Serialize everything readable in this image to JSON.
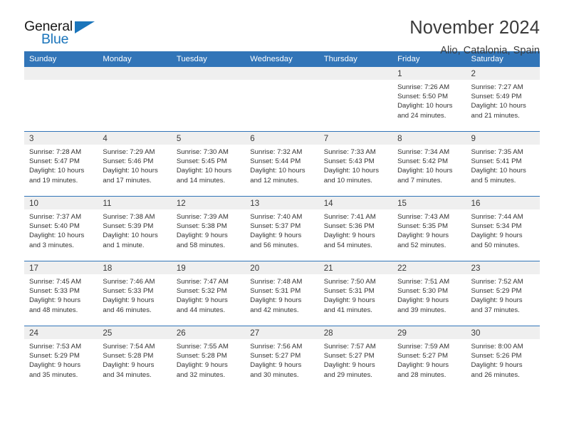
{
  "brand": {
    "name_part1": "General",
    "name_part2": "Blue",
    "accent_color": "#1b75bb"
  },
  "header": {
    "title": "November 2024",
    "location": "Alio, Catalonia, Spain",
    "header_bg": "#3275b8"
  },
  "calendar": {
    "weekday_headers": [
      "Sunday",
      "Monday",
      "Tuesday",
      "Wednesday",
      "Thursday",
      "Friday",
      "Saturday"
    ],
    "weeks": [
      [
        {
          "day": "",
          "blank": true
        },
        {
          "day": "",
          "blank": true
        },
        {
          "day": "",
          "blank": true
        },
        {
          "day": "",
          "blank": true
        },
        {
          "day": "",
          "blank": true
        },
        {
          "day": "1",
          "sunrise": "Sunrise: 7:26 AM",
          "sunset": "Sunset: 5:50 PM",
          "daylight": "Daylight: 10 hours and 24 minutes."
        },
        {
          "day": "2",
          "sunrise": "Sunrise: 7:27 AM",
          "sunset": "Sunset: 5:49 PM",
          "daylight": "Daylight: 10 hours and 21 minutes."
        }
      ],
      [
        {
          "day": "3",
          "sunrise": "Sunrise: 7:28 AM",
          "sunset": "Sunset: 5:47 PM",
          "daylight": "Daylight: 10 hours and 19 minutes."
        },
        {
          "day": "4",
          "sunrise": "Sunrise: 7:29 AM",
          "sunset": "Sunset: 5:46 PM",
          "daylight": "Daylight: 10 hours and 17 minutes."
        },
        {
          "day": "5",
          "sunrise": "Sunrise: 7:30 AM",
          "sunset": "Sunset: 5:45 PM",
          "daylight": "Daylight: 10 hours and 14 minutes."
        },
        {
          "day": "6",
          "sunrise": "Sunrise: 7:32 AM",
          "sunset": "Sunset: 5:44 PM",
          "daylight": "Daylight: 10 hours and 12 minutes."
        },
        {
          "day": "7",
          "sunrise": "Sunrise: 7:33 AM",
          "sunset": "Sunset: 5:43 PM",
          "daylight": "Daylight: 10 hours and 10 minutes."
        },
        {
          "day": "8",
          "sunrise": "Sunrise: 7:34 AM",
          "sunset": "Sunset: 5:42 PM",
          "daylight": "Daylight: 10 hours and 7 minutes."
        },
        {
          "day": "9",
          "sunrise": "Sunrise: 7:35 AM",
          "sunset": "Sunset: 5:41 PM",
          "daylight": "Daylight: 10 hours and 5 minutes."
        }
      ],
      [
        {
          "day": "10",
          "sunrise": "Sunrise: 7:37 AM",
          "sunset": "Sunset: 5:40 PM",
          "daylight": "Daylight: 10 hours and 3 minutes."
        },
        {
          "day": "11",
          "sunrise": "Sunrise: 7:38 AM",
          "sunset": "Sunset: 5:39 PM",
          "daylight": "Daylight: 10 hours and 1 minute."
        },
        {
          "day": "12",
          "sunrise": "Sunrise: 7:39 AM",
          "sunset": "Sunset: 5:38 PM",
          "daylight": "Daylight: 9 hours and 58 minutes."
        },
        {
          "day": "13",
          "sunrise": "Sunrise: 7:40 AM",
          "sunset": "Sunset: 5:37 PM",
          "daylight": "Daylight: 9 hours and 56 minutes."
        },
        {
          "day": "14",
          "sunrise": "Sunrise: 7:41 AM",
          "sunset": "Sunset: 5:36 PM",
          "daylight": "Daylight: 9 hours and 54 minutes."
        },
        {
          "day": "15",
          "sunrise": "Sunrise: 7:43 AM",
          "sunset": "Sunset: 5:35 PM",
          "daylight": "Daylight: 9 hours and 52 minutes."
        },
        {
          "day": "16",
          "sunrise": "Sunrise: 7:44 AM",
          "sunset": "Sunset: 5:34 PM",
          "daylight": "Daylight: 9 hours and 50 minutes."
        }
      ],
      [
        {
          "day": "17",
          "sunrise": "Sunrise: 7:45 AM",
          "sunset": "Sunset: 5:33 PM",
          "daylight": "Daylight: 9 hours and 48 minutes."
        },
        {
          "day": "18",
          "sunrise": "Sunrise: 7:46 AM",
          "sunset": "Sunset: 5:33 PM",
          "daylight": "Daylight: 9 hours and 46 minutes."
        },
        {
          "day": "19",
          "sunrise": "Sunrise: 7:47 AM",
          "sunset": "Sunset: 5:32 PM",
          "daylight": "Daylight: 9 hours and 44 minutes."
        },
        {
          "day": "20",
          "sunrise": "Sunrise: 7:48 AM",
          "sunset": "Sunset: 5:31 PM",
          "daylight": "Daylight: 9 hours and 42 minutes."
        },
        {
          "day": "21",
          "sunrise": "Sunrise: 7:50 AM",
          "sunset": "Sunset: 5:31 PM",
          "daylight": "Daylight: 9 hours and 41 minutes."
        },
        {
          "day": "22",
          "sunrise": "Sunrise: 7:51 AM",
          "sunset": "Sunset: 5:30 PM",
          "daylight": "Daylight: 9 hours and 39 minutes."
        },
        {
          "day": "23",
          "sunrise": "Sunrise: 7:52 AM",
          "sunset": "Sunset: 5:29 PM",
          "daylight": "Daylight: 9 hours and 37 minutes."
        }
      ],
      [
        {
          "day": "24",
          "sunrise": "Sunrise: 7:53 AM",
          "sunset": "Sunset: 5:29 PM",
          "daylight": "Daylight: 9 hours and 35 minutes."
        },
        {
          "day": "25",
          "sunrise": "Sunrise: 7:54 AM",
          "sunset": "Sunset: 5:28 PM",
          "daylight": "Daylight: 9 hours and 34 minutes."
        },
        {
          "day": "26",
          "sunrise": "Sunrise: 7:55 AM",
          "sunset": "Sunset: 5:28 PM",
          "daylight": "Daylight: 9 hours and 32 minutes."
        },
        {
          "day": "27",
          "sunrise": "Sunrise: 7:56 AM",
          "sunset": "Sunset: 5:27 PM",
          "daylight": "Daylight: 9 hours and 30 minutes."
        },
        {
          "day": "28",
          "sunrise": "Sunrise: 7:57 AM",
          "sunset": "Sunset: 5:27 PM",
          "daylight": "Daylight: 9 hours and 29 minutes."
        },
        {
          "day": "29",
          "sunrise": "Sunrise: 7:59 AM",
          "sunset": "Sunset: 5:27 PM",
          "daylight": "Daylight: 9 hours and 28 minutes."
        },
        {
          "day": "30",
          "sunrise": "Sunrise: 8:00 AM",
          "sunset": "Sunset: 5:26 PM",
          "daylight": "Daylight: 9 hours and 26 minutes."
        }
      ]
    ]
  }
}
